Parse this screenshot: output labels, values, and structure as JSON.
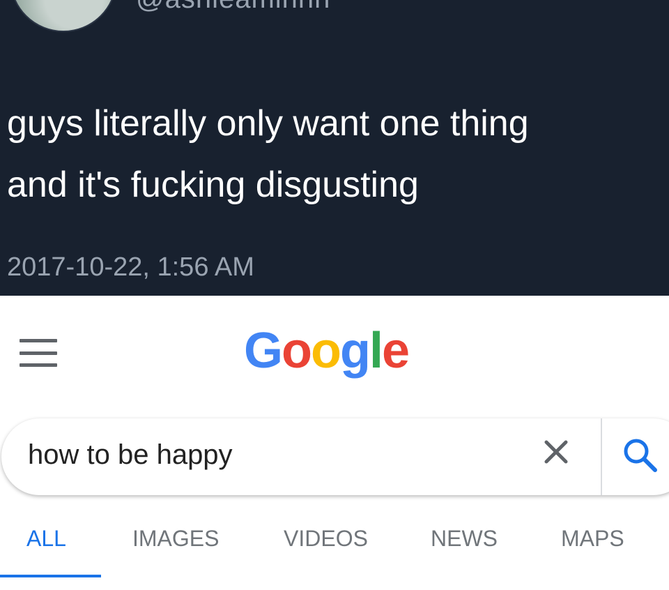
{
  "tweet": {
    "handle": "@ashleaminnn",
    "text_lines": [
      "guys literally only want one thing",
      "and it's fucking disgusting"
    ],
    "timestamp": "2017-10-22, 1:56 AM"
  },
  "google": {
    "logo": {
      "letters": [
        "G",
        "o",
        "o",
        "g",
        "l",
        "e"
      ],
      "colors": [
        "#4285F4",
        "#EA4335",
        "#FBBC05",
        "#4285F4",
        "#34A853",
        "#EA4335"
      ]
    },
    "search": {
      "value": "how to be happy",
      "placeholder": ""
    },
    "tabs": [
      {
        "label": "ALL",
        "active": true
      },
      {
        "label": "IMAGES",
        "active": false
      },
      {
        "label": "VIDEOS",
        "active": false
      },
      {
        "label": "NEWS",
        "active": false
      },
      {
        "label": "MAPS",
        "active": false
      }
    ],
    "accent_color": "#1a73e8"
  },
  "icons": {
    "menu": "hamburger-menu-icon",
    "clear": "close-icon",
    "search": "search-icon"
  }
}
